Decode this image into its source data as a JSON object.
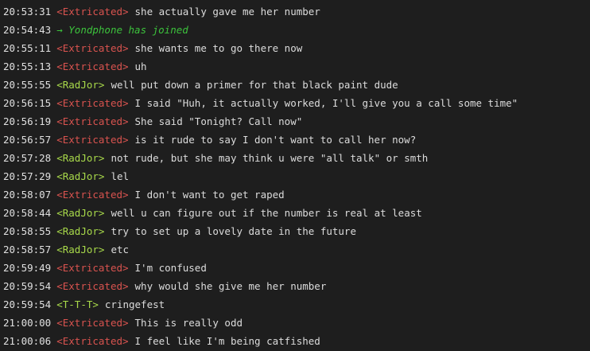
{
  "messages": [
    {
      "time": "20:53:31",
      "nick": "<Extricated>",
      "text": "she actually gave me her number",
      "kind": "extricated"
    },
    {
      "time": "20:54:43",
      "join": "→ Yondphone has joined"
    },
    {
      "time": "20:55:11",
      "nick": "<Extricated>",
      "text": "she wants me to go there now",
      "kind": "extricated"
    },
    {
      "time": "20:55:13",
      "nick": "<Extricated>",
      "text": "uh",
      "kind": "extricated"
    },
    {
      "time": "20:55:55",
      "nick": "<RadJor>",
      "text": "well put down a primer for that black paint dude",
      "kind": "radjor"
    },
    {
      "time": "20:56:15",
      "nick": "<Extricated>",
      "text": "I said \"Huh, it actually worked, I'll give you a call some time\"",
      "kind": "extricated"
    },
    {
      "time": "20:56:19",
      "nick": "<Extricated>",
      "text": "She said \"Tonight? Call now\"",
      "kind": "extricated"
    },
    {
      "time": "20:56:57",
      "nick": "<Extricated>",
      "text": "is it rude to say I don't want to call her now?",
      "kind": "extricated"
    },
    {
      "time": "20:57:28",
      "nick": "<RadJor>",
      "text": "not rude, but she may think u were \"all talk\" or smth",
      "kind": "radjor"
    },
    {
      "time": "20:57:29",
      "nick": "<RadJor>",
      "text": "lel",
      "kind": "radjor"
    },
    {
      "time": "20:58:07",
      "nick": "<Extricated>",
      "text": "I don't want to get raped",
      "kind": "extricated"
    },
    {
      "time": "20:58:44",
      "nick": "<RadJor>",
      "text": "well u can figure out if the number is real at least",
      "kind": "radjor"
    },
    {
      "time": "20:58:55",
      "nick": "<RadJor>",
      "text": "try to set up a lovely date in the future",
      "kind": "radjor"
    },
    {
      "time": "20:58:57",
      "nick": "<RadJor>",
      "text": "etc",
      "kind": "radjor"
    },
    {
      "time": "20:59:49",
      "nick": "<Extricated>",
      "text": "I'm confused",
      "kind": "extricated"
    },
    {
      "time": "20:59:54",
      "nick": "<Extricated>",
      "text": "why would she give me her number",
      "kind": "extricated"
    },
    {
      "time": "20:59:54",
      "nick": "<T-T-T>",
      "text": "cringefest",
      "kind": "ttt"
    },
    {
      "time": "21:00:00",
      "nick": "<Extricated>",
      "text": "This is really odd",
      "kind": "extricated"
    },
    {
      "time": "21:00:06",
      "nick": "<Extricated>",
      "text": "I feel like I'm being catfished",
      "kind": "extricated"
    }
  ],
  "colors": {
    "background": "#1e1e1e",
    "extricated": "#d9534f",
    "radjor": "#a8d94a",
    "join": "#3cc23c"
  }
}
